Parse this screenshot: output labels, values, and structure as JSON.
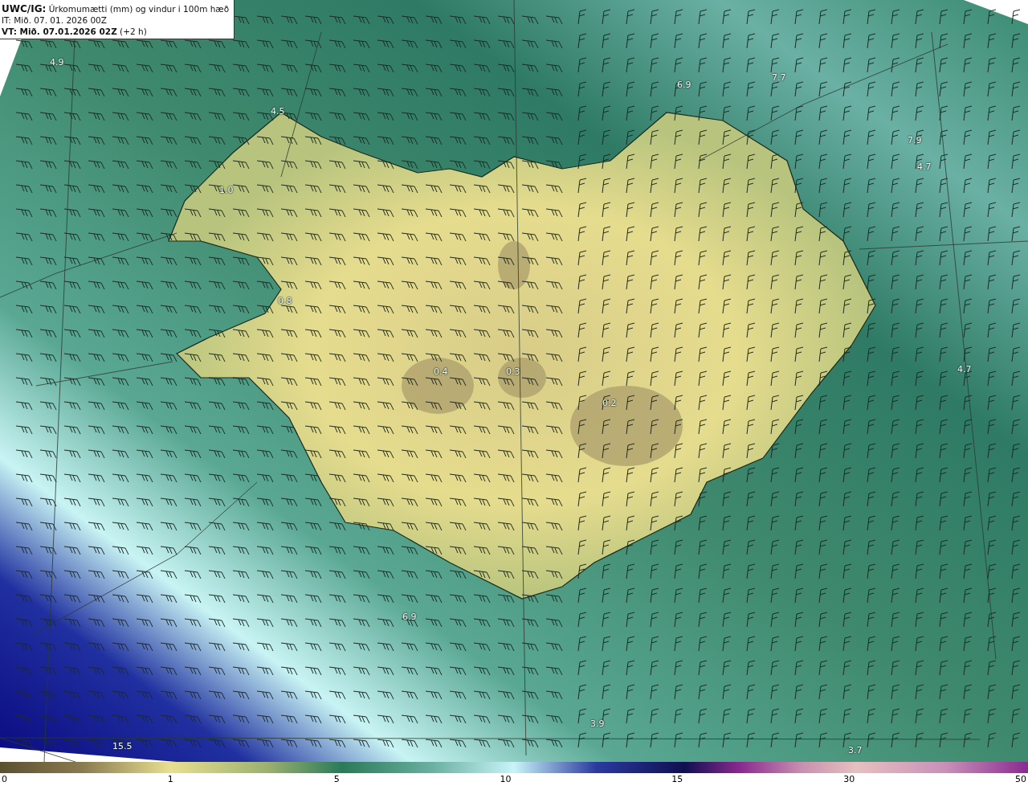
{
  "header": {
    "title": "**UWC/IG:** Úrkomumætti (mm) og vindur i 100m hæð",
    "issue_time": "IT: Mið. 07. 01. 2026 00Z",
    "valid_time": "**VT: Mið. 07.01.2026 02Z** (+2 h)"
  },
  "map": {
    "value_labels": [
      "4.9",
      "4.5",
      "6.9",
      "7.7",
      "7.9",
      "4.7",
      "1.0",
      "0.8",
      "0.4",
      "0.3",
      "0.2",
      "4.7",
      "6.9",
      "3.9",
      "3.7",
      "15.5"
    ]
  },
  "legend": {
    "ticks": [
      "0",
      "1",
      "5",
      "10",
      "15",
      "30",
      "50"
    ]
  }
}
